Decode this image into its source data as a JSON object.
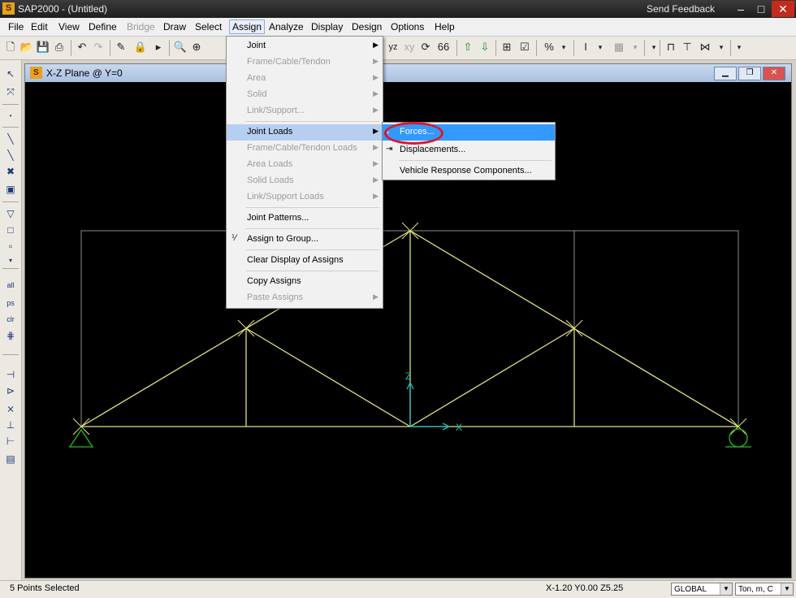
{
  "window": {
    "app_title": "SAP2000 - (Untitled)",
    "feedback": "Send Feedback",
    "minimize": "–",
    "maximize": "□",
    "close": "✕"
  },
  "menubar": [
    "File",
    "Edit",
    "View",
    "Define",
    "Bridge",
    "Draw",
    "Select",
    "Assign",
    "Analyze",
    "Display",
    "Design",
    "Options",
    "Help"
  ],
  "toolbar": {
    "plane_label": "yz",
    "percent": "%"
  },
  "view_window": {
    "title": "X-Z Plane @ Y=0"
  },
  "assign_menu": {
    "items": [
      {
        "label": "Joint",
        "enabled": true,
        "submenu": true
      },
      {
        "label": "Frame/Cable/Tendon",
        "enabled": false,
        "submenu": true
      },
      {
        "label": "Area",
        "enabled": false,
        "submenu": true
      },
      {
        "label": "Solid",
        "enabled": false,
        "submenu": true
      },
      {
        "label": "Link/Support...",
        "enabled": false,
        "submenu": true
      },
      {
        "label": "Joint Loads",
        "enabled": true,
        "submenu": true,
        "highlighted": true
      },
      {
        "label": "Frame/Cable/Tendon Loads",
        "enabled": false,
        "submenu": true
      },
      {
        "label": "Area Loads",
        "enabled": false,
        "submenu": true
      },
      {
        "label": "Solid Loads",
        "enabled": false,
        "submenu": true
      },
      {
        "label": "Link/Support Loads",
        "enabled": false,
        "submenu": true
      },
      {
        "label": "Joint Patterns...",
        "enabled": true
      },
      {
        "label": "Assign to Group...",
        "enabled": true
      },
      {
        "label": "Clear Display of Assigns",
        "enabled": true
      },
      {
        "label": "Copy Assigns",
        "enabled": true
      },
      {
        "label": "Paste Assigns",
        "enabled": false,
        "submenu": true
      }
    ]
  },
  "joint_loads_submenu": {
    "items": [
      {
        "label": "Forces...",
        "active": true
      },
      {
        "label": "Displacements..."
      },
      {
        "label": "Vehicle Response Components..."
      }
    ]
  },
  "axes": {
    "z_label": "Z",
    "x_label": "X"
  },
  "colors": {
    "truss": "#e2e27a",
    "grid": "#8c8c8c",
    "support": "#20c020",
    "axis": "#20c0c0",
    "highlight": "#3399ff",
    "annotation": "#d9192a"
  },
  "status": {
    "selection": "5 Points Selected",
    "coords": "X-1.20  Y0.00  Z5.25",
    "coord_system": "GLOBAL",
    "units": "Ton, m, C"
  }
}
